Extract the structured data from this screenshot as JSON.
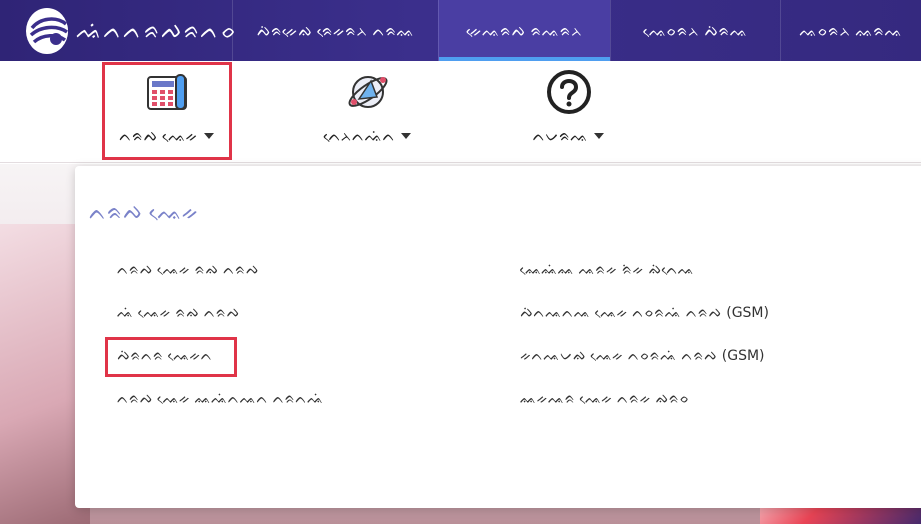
{
  "header": {
    "logo_text": "ᨕᨗᨈᨈᨑᨄᨑᨈᨔ",
    "tabs": [
      {
        "label": "ᨄᨗᨑᨀᨙᨁ ᨑᨙᨀᨑᨂ ᨈᨑᨐ"
      },
      {
        "label": "ᨀᨙᨕᨑᨄ ᨑᨕᨑᨂ"
      },
      {
        "label": "ᨕᨙᨔᨑᨂ ᨄᨗᨑᨕ"
      },
      {
        "label": "ᨕᨔᨑᨂ ᨐᨑᨕ"
      }
    ],
    "active_tab_index": 1
  },
  "subnav": {
    "items": [
      {
        "label": "ᨈᨑᨄ ᨕᨙᨀ",
        "icon": "phone-icon"
      },
      {
        "label": "ᨈᨙᨂᨈᨕᨗᨈ",
        "icon": "satellite-icon"
      },
      {
        "label": "ᨈᨆᨑᨕ",
        "icon": "help-icon"
      }
    ]
  },
  "dropdown": {
    "title": "ᨈᨑᨄ ᨕᨙᨀ",
    "left_links": [
      "ᨈᨑᨄ ᨕᨙᨀ ᨑᨁ ᨈᨑᨄ",
      "ᨕᨗ ᨕᨙᨀ ᨑᨁ ᨈᨑᨄ",
      "ᨄᨗᨑᨈᨑ ᨕᨙᨀᨈ",
      "ᨈᨑᨄ ᨕᨙᨀ ᨐᨕᨗᨈᨕᨈ ᨈᨑᨈᨕᨗ"
    ],
    "right_links": [
      "ᨐᨙᨐᨗᨐ ᨕᨑᨀ ᨑᨗᨀ ᨁᨗᨈᨙᨕ",
      "ᨄᨗᨈᨕᨈᨕ ᨕᨙᨀ ᨈᨔᨑᨕᨗ ᨈᨑᨄ (GSM)",
      "ᨀᨈᨕᨆᨁ ᨕᨙᨀ ᨈᨔᨑᨕᨗ ᨈᨑᨄ (GSM)",
      "ᨐᨀᨕᨑ ᨕᨙᨀ ᨈᨑᨀ ᨁᨑᨔ"
    ]
  },
  "colors": {
    "navbar": "#35297f",
    "active_tab_indicator": "#4f9ef0",
    "highlight": "#e03448",
    "dropdown_title": "#7a82c9"
  }
}
